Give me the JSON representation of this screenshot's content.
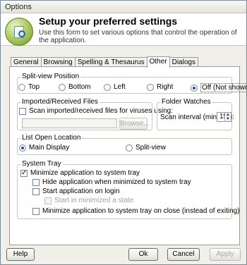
{
  "window": {
    "title": "Options"
  },
  "header": {
    "title": "Setup your preferred settings",
    "subtitle": "Use this form to set various options that control the operation of the application."
  },
  "tabs": [
    {
      "label": "General",
      "active": false
    },
    {
      "label": "Browsing",
      "active": false
    },
    {
      "label": "Spelling & Thesaurus",
      "active": false
    },
    {
      "label": "Other",
      "active": true
    },
    {
      "label": "Dialogs",
      "active": false
    }
  ],
  "split_view_position": {
    "legend": "Split-view Position",
    "options": [
      {
        "label": "Top",
        "selected": false
      },
      {
        "label": "Bottom",
        "selected": false
      },
      {
        "label": "Left",
        "selected": false
      },
      {
        "label": "Right",
        "selected": false
      },
      {
        "label": "Off (Not shown)",
        "selected": true
      }
    ]
  },
  "imported_files": {
    "legend": "Imported/Received Files",
    "scan_label": "Scan imported/received files for viruses using:",
    "scan_checked": false,
    "path_value": "",
    "browse_label": "Browse..."
  },
  "folder_watches": {
    "legend": "Folder Watches",
    "interval_label": "Scan interval (minutes):",
    "interval_value": "15"
  },
  "list_open_location": {
    "legend": "List Open Location",
    "options": [
      {
        "label": "Main Display",
        "selected": true
      },
      {
        "label": "Split-view",
        "selected": false
      }
    ]
  },
  "system_tray": {
    "legend": "System Tray",
    "minimize_to_tray": {
      "label": "Minimize application to system tray",
      "checked": true
    },
    "hide_when_minimized": {
      "label": "Hide application when minimized to system tray",
      "checked": false
    },
    "start_on_login": {
      "label": "Start application on login",
      "checked": false
    },
    "start_minimized": {
      "label": "Start in minimized a state",
      "checked": false
    },
    "minimize_on_close": {
      "label": "Minimize application to system tray on close (instead of exiting)",
      "checked": false
    }
  },
  "buttons": {
    "help": "Help",
    "ok": "Ok",
    "cancel": "Cancel",
    "apply": "Apply"
  },
  "colors": {
    "accent": "#1c4f9a",
    "logo_green": "#8fb843"
  }
}
